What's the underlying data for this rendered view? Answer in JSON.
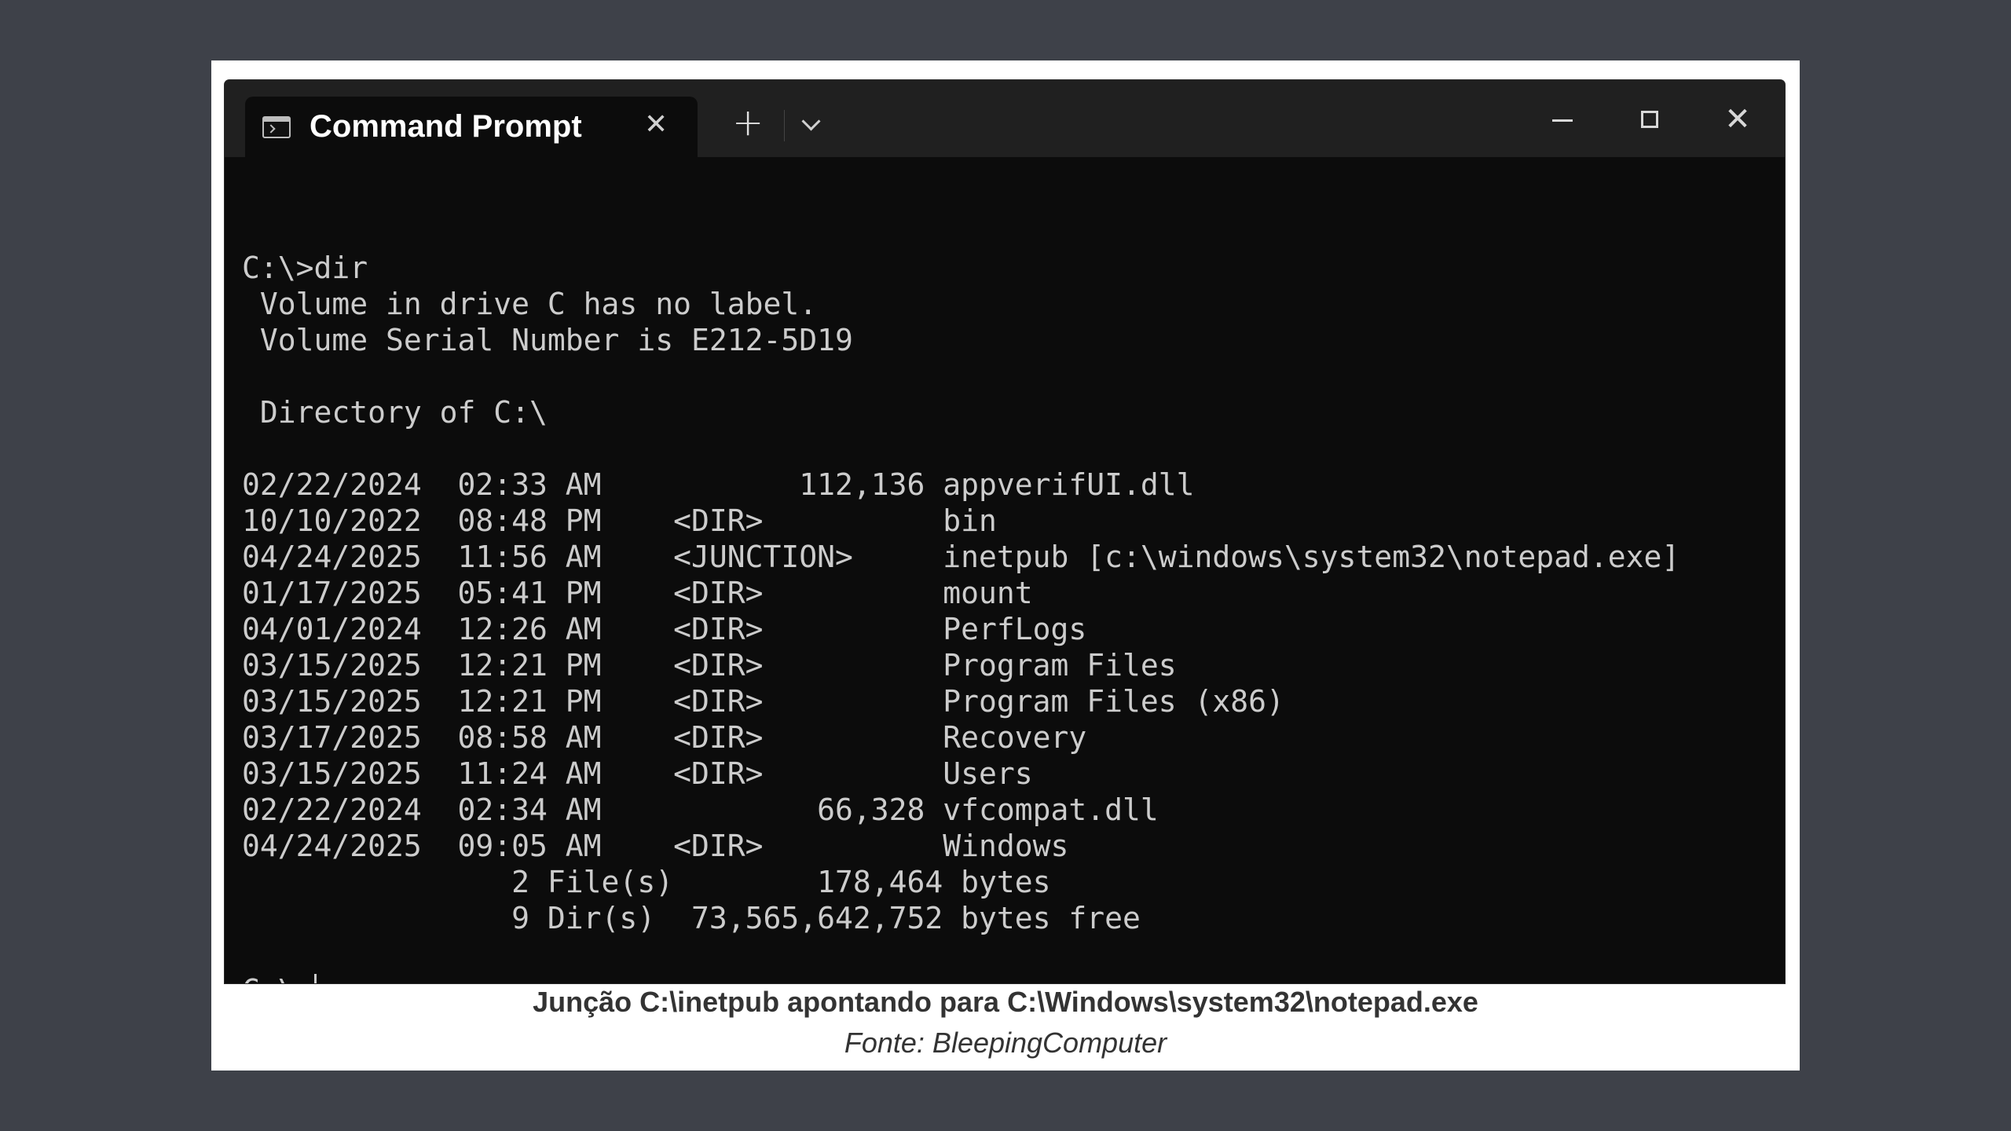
{
  "window": {
    "tab_title": "Command Prompt",
    "tab_close_icon": "close-icon",
    "new_tab_label": "+",
    "dropdown_icon": "chevron-down-icon",
    "close_label": "✕",
    "tab_icon": "terminal-icon"
  },
  "terminal": {
    "lines": [
      "",
      "C:\\>dir",
      " Volume in drive C has no label.",
      " Volume Serial Number is E212-5D19",
      "",
      " Directory of C:\\",
      "",
      "02/22/2024  02:33 AM           112,136 appverifUI.dll",
      "10/10/2022  08:48 PM    <DIR>          bin",
      "04/24/2025  11:56 AM    <JUNCTION>     inetpub [c:\\windows\\system32\\notepad.exe]",
      "01/17/2025  05:41 PM    <DIR>          mount",
      "04/01/2024  12:26 AM    <DIR>          PerfLogs",
      "03/15/2025  12:21 PM    <DIR>          Program Files",
      "03/15/2025  12:21 PM    <DIR>          Program Files (x86)",
      "03/17/2025  08:58 AM    <DIR>          Recovery",
      "03/15/2025  11:24 AM    <DIR>          Users",
      "02/22/2024  02:34 AM            66,328 vfcompat.dll",
      "04/24/2025  09:05 AM    <DIR>          Windows",
      "               2 File(s)        178,464 bytes",
      "               9 Dir(s)  73,565,642,752 bytes free",
      ""
    ],
    "prompt": "C:\\>"
  },
  "caption": {
    "title": "Junção C:\\inetpub apontando para C:\\Windows\\system32\\notepad.exe",
    "source": "Fonte: BleepingComputer"
  },
  "colors": {
    "background": "#3e4149",
    "terminal_bg": "#0c0c0c",
    "titlebar_bg": "#202020",
    "terminal_text": "#cccccc"
  }
}
